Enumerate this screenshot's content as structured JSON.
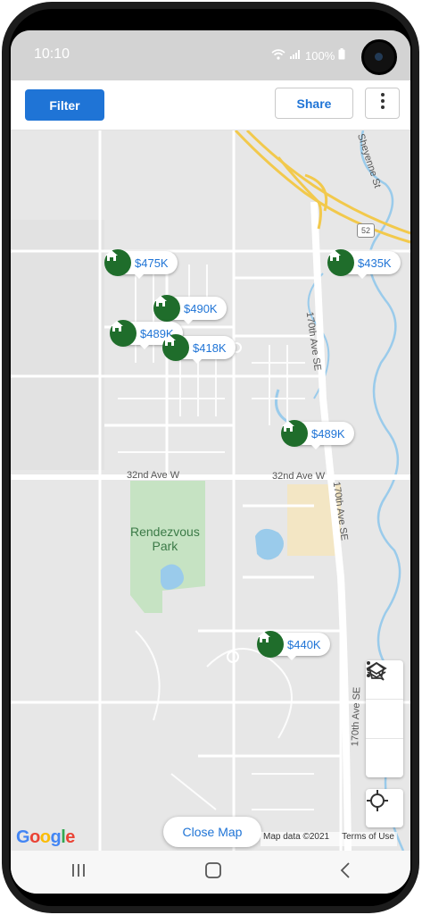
{
  "status": {
    "time": "10:10",
    "battery": "100%"
  },
  "toolbar": {
    "filter_label": "Filter",
    "share_label": "Share"
  },
  "listings": [
    {
      "price": "$475K"
    },
    {
      "price": "$490K"
    },
    {
      "price": "$489K"
    },
    {
      "price": "$418K"
    },
    {
      "price": "$435K"
    },
    {
      "price": "$489K"
    },
    {
      "price": "$440K"
    }
  ],
  "map": {
    "roads": {
      "north": "Sheyenne St",
      "east_upper": "170th Ave SE",
      "east_lower": "170th Ave SE",
      "east_bottom": "170th Ave SE",
      "cross_left": "32nd Ave W",
      "cross_right": "32nd Ave W",
      "highway": "52"
    },
    "park": {
      "line1": "Rendezvous",
      "line2": "Park"
    },
    "close_label": "Close Map",
    "attribution": {
      "data": "Map data ©2021",
      "terms": "Terms of Use"
    },
    "brand": "Google"
  },
  "colors": {
    "accent": "#1f74d6",
    "pin": "#1f6d2b",
    "highway": "#f2c94c",
    "water": "#8ec4e8",
    "park": "#c8e6c9"
  }
}
